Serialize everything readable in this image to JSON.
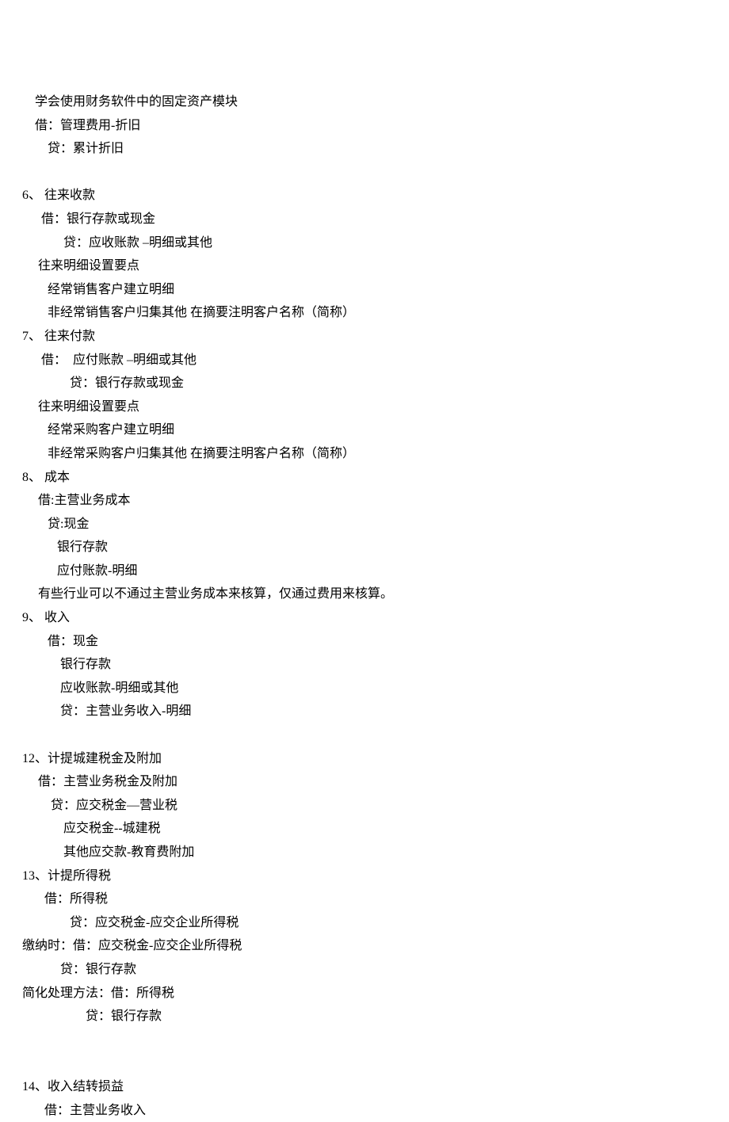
{
  "lines": [
    "           学会使用财务软件中的固定资产模块",
    "           借：管理费用-折旧",
    "               贷：累计折旧",
    "",
    "       6、 往来收款",
    "             借：银行存款或现金",
    "                    贷：应收账款 –明细或其他",
    "            往来明细设置要点",
    "               经常销售客户建立明细",
    "               非经常销售客户归集其他 在摘要注明客户名称（简称）",
    "       7、 往来付款",
    "             借：  应付账款 –明细或其他",
    "                      贷：银行存款或现金",
    "            往来明细设置要点",
    "               经常采购客户建立明细",
    "               非经常采购客户归集其他 在摘要注明客户名称（简称）",
    "       8、 成本",
    "            借:主营业务成本",
    "               贷:现金",
    "                  银行存款",
    "                  应付账款-明细",
    "            有些行业可以不通过主营业务成本来核算，仅通过费用来核算。",
    "       9、 收入",
    "               借：现金",
    "                   银行存款",
    "                   应收账款-明细或其他",
    "                   贷：主营业务收入-明细",
    "",
    "       12、计提城建税金及附加",
    "            借：主营业务税金及附加",
    "                贷：应交税金—营业税",
    "                    应交税金--城建税",
    "                    其他应交款-教育费附加",
    "       13、计提所得税",
    "              借：所得税",
    "                      贷：应交税金-应交企业所得税",
    "       缴纳时：借：应交税金-应交企业所得税",
    "                   贷：银行存款",
    "       简化处理方法：借：所得税",
    "                           贷：银行存款",
    "",
    "",
    "       14、收入结转损益",
    "              借：主营业务收入"
  ]
}
